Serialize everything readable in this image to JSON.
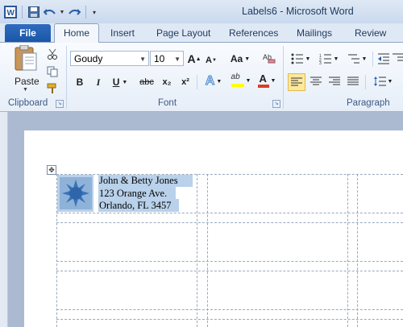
{
  "window": {
    "title": "Labels6  -  Microsoft Word"
  },
  "quick_access": {
    "icons": [
      "word-app-icon",
      "save-icon",
      "undo-icon",
      "undo-dropdown-icon",
      "redo-icon",
      "customize-qat-icon"
    ]
  },
  "tabs": [
    "File",
    "Home",
    "Insert",
    "Page Layout",
    "References",
    "Mailings",
    "Review"
  ],
  "active_tab": "Home",
  "ribbon": {
    "clipboard": {
      "paste_label": "Paste",
      "group_label": "Clipboard"
    },
    "font": {
      "font_name": "Goudy",
      "font_size": "10",
      "group_label": "Font",
      "bold": "B",
      "italic": "I",
      "underline": "U",
      "strikethrough": "abc",
      "subscript": "x₂",
      "superscript": "x²",
      "grow_font": "A",
      "shrink_font": "A",
      "change_case": "Aa",
      "text_effects": "A",
      "highlight": "ab",
      "font_color": "A",
      "highlight_color": "#ffff00",
      "font_color_swatch": "#e03a28"
    },
    "paragraph": {
      "group_label": "Paragraph"
    }
  },
  "label": {
    "lines": [
      "John &  Betty Jones",
      "123 Orange  Ave.",
      "Orlando,  FL 3457"
    ]
  }
}
